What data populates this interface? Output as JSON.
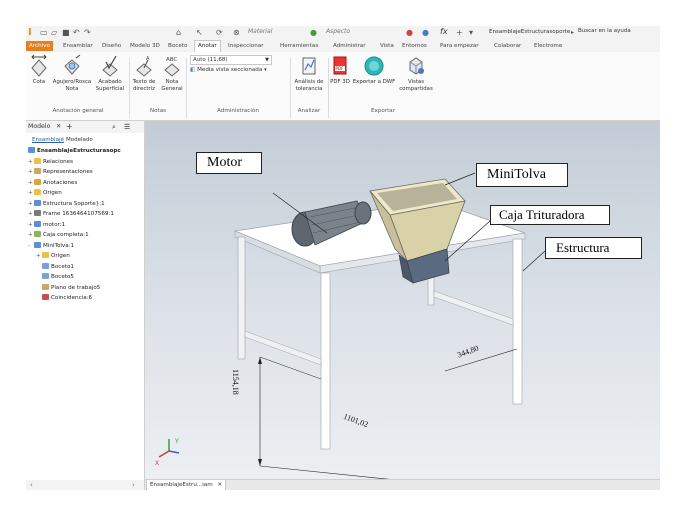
{
  "quick_access": {
    "material_label": "Material",
    "appearance_label": "Aspecto",
    "fx_label": "fx",
    "document_name": "EnsamblajeEstructurasoporte",
    "search_label": "Buscar en la ayuda"
  },
  "ribbon_tabs": [
    "Archivo",
    "Ensamblar",
    "Diseño",
    "Modelo 3D",
    "Boceto",
    "Anotar",
    "Inspeccionar",
    "Herramientas",
    "Administrar",
    "Vista",
    "Entornos",
    "Para empezar",
    "Colaborar",
    "Electrome"
  ],
  "active_tab": "Anotar",
  "ribbon": {
    "cota": "Cota",
    "agujero_l1": "Agujero/Rosca",
    "agujero_l2": "Nota",
    "acabado_l1": "Acabado",
    "acabado_l2": "Superficial",
    "texto_l1": "Texto de",
    "texto_l2": "directriz",
    "nota_l1": "Nota",
    "nota_l2": "General",
    "scale_value": "Auto (11,68)",
    "media_vista": "Media vista seccionada",
    "analisis_l1": "Análisis de",
    "analisis_l2": "tolerancia",
    "pdf3d": "PDF 3D",
    "exportar_dwf": "Exportar a DWF",
    "vistas_l1": "Vistas",
    "vistas_l2": "compartidas",
    "group_anotacion": "Anotación general",
    "group_notas": "Notas",
    "group_administracion": "Administración",
    "group_analizar": "Analizar",
    "group_exportar": "Exportar"
  },
  "browser": {
    "title": "Modelo",
    "sub_ensamblaje": "Ensamblaje",
    "sub_modelado": "Modelado",
    "root": "EnsamblajeEstructurasopc",
    "items": [
      {
        "pm": "+",
        "label": "Relaciones",
        "color": "#e8c24a"
      },
      {
        "pm": "+",
        "label": "Representaciones",
        "color": "#c9a86a"
      },
      {
        "pm": "+",
        "label": "Anotaciones",
        "color": "#e0a23a"
      },
      {
        "pm": "+",
        "label": "Origen",
        "color": "#e8c24a"
      },
      {
        "pm": "+",
        "label": "Estructura Soporte}:1",
        "color": "#5b8fd6"
      },
      {
        "pm": "+",
        "label": "Frame 1636464107569:1",
        "color": "#7a7a7a"
      },
      {
        "pm": "+",
        "label": "motor:1",
        "color": "#5b8fd6"
      },
      {
        "pm": "+",
        "label": "Caja completa:1",
        "color": "#8fb35a"
      },
      {
        "pm": "-",
        "label": "MiniTolva:1",
        "color": "#5b8fd6"
      }
    ],
    "children": [
      {
        "label": "Origen",
        "color": "#e8c24a"
      },
      {
        "label": "Boceto1",
        "color": "#7aa0d8"
      },
      {
        "label": "Boceto5",
        "color": "#7aa0d8"
      },
      {
        "label": "Plano de trabajo5",
        "color": "#c9a86a"
      },
      {
        "label": "Coincidencia:6",
        "color": "#c85050"
      }
    ]
  },
  "document_tab": "EnsamblajeEstru...iam",
  "callouts": {
    "motor": "Motor",
    "minitolva": "MiniTolva",
    "caja": "Caja Trituradora",
    "estructura": "Estructura"
  },
  "dimensions": {
    "height": "1154,18",
    "width": "344,80",
    "length": "1101,02"
  }
}
